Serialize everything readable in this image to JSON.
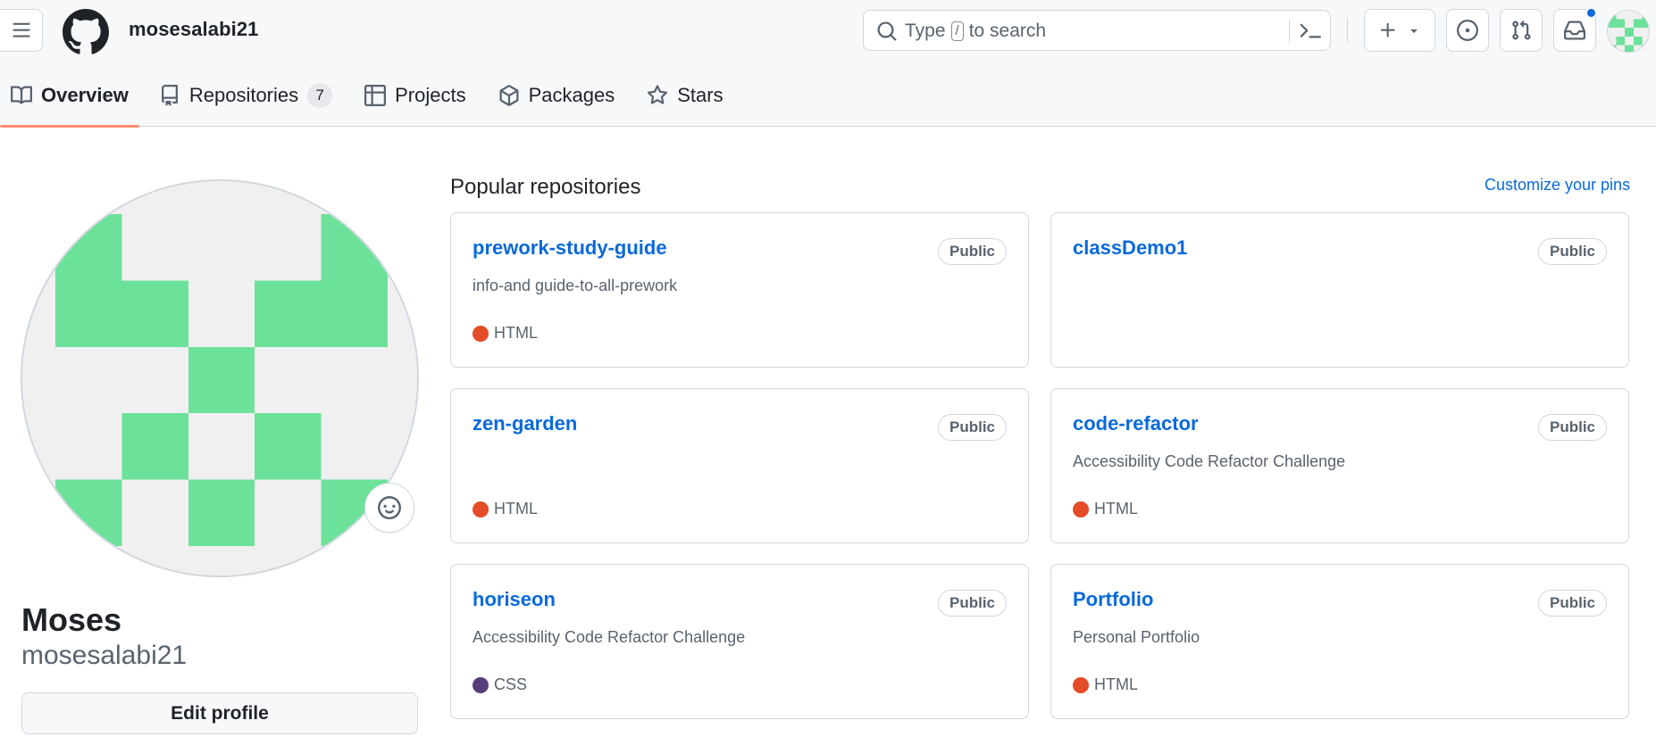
{
  "header": {
    "owner": "mosesalabi21",
    "search": {
      "prefix": "Type",
      "key": "/",
      "suffix": "to search"
    },
    "accent": "#0969da"
  },
  "tabs": [
    {
      "label": "Overview",
      "icon": "book-icon",
      "selected": true
    },
    {
      "label": "Repositories",
      "icon": "repo-icon",
      "count": "7"
    },
    {
      "label": "Projects",
      "icon": "table-icon"
    },
    {
      "label": "Packages",
      "icon": "package-icon"
    },
    {
      "label": "Stars",
      "icon": "star-icon"
    }
  ],
  "profile": {
    "full_name": "Moses",
    "username": "mosesalabi21",
    "edit_button": "Edit profile",
    "identicon_color": "#6ce19a"
  },
  "pinned": {
    "title": "Popular repositories",
    "customize_link": "Customize your pins",
    "repos": [
      {
        "name": "prework-study-guide",
        "visibility": "Public",
        "description": "info-and guide-to-all-prework",
        "language": "HTML",
        "language_color": "#e34c26"
      },
      {
        "name": "classDemo1",
        "visibility": "Public",
        "description": "",
        "language": "",
        "language_color": ""
      },
      {
        "name": "zen-garden",
        "visibility": "Public",
        "description": "",
        "language": "HTML",
        "language_color": "#e34c26"
      },
      {
        "name": "code-refactor",
        "visibility": "Public",
        "description": "Accessibility Code Refactor Challenge",
        "language": "HTML",
        "language_color": "#e34c26"
      },
      {
        "name": "horiseon",
        "visibility": "Public",
        "description": "Accessibility Code Refactor Challenge",
        "language": "CSS",
        "language_color": "#563d7c"
      },
      {
        "name": "Portfolio",
        "visibility": "Public",
        "description": "Personal Portfolio",
        "language": "HTML",
        "language_color": "#e34c26"
      }
    ]
  }
}
